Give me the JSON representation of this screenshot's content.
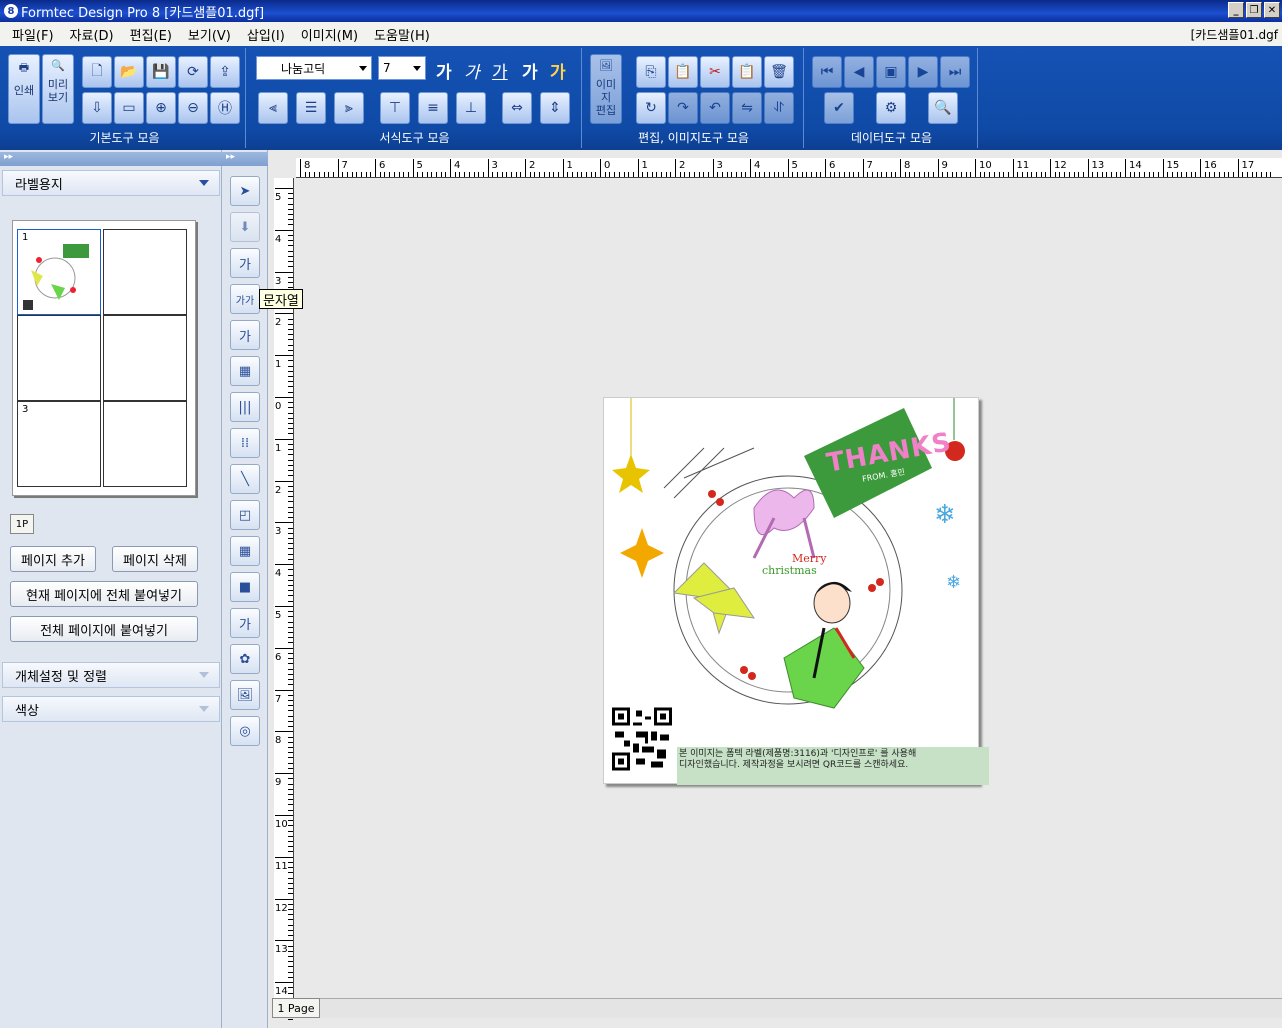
{
  "window": {
    "title": "Formtec Design Pro 8 [카드샘플01.dgf]",
    "doc_label": "[카드샘플01.dgf"
  },
  "menu": [
    "파일(F)",
    "자료(D)",
    "편집(E)",
    "보기(V)",
    "삽입(I)",
    "이미지(M)",
    "도움말(H)"
  ],
  "ribbon": {
    "basic": {
      "label": "기본도구 모음",
      "print": "인쇄",
      "preview_l1": "미리",
      "preview_l2": "보기"
    },
    "format": {
      "label": "서식도구 모음",
      "font": "나눔고딕",
      "size": "7",
      "ga": [
        "가",
        "가",
        "가",
        "가",
        "가"
      ]
    },
    "edit": {
      "label": "편집, 이미지도구 모음",
      "imgedit_l1": "이미지",
      "imgedit_l2": "편집"
    },
    "data": {
      "label": "데이터도구 모음"
    }
  },
  "left": {
    "paper_title": "라벨용지",
    "cells": [
      "1",
      "",
      "",
      "",
      "3",
      ""
    ],
    "page_tab": "1P",
    "add_page": "페이지 추가",
    "delete_page": "페이지 삭제",
    "paste_all_current": "현재 페이지에 전체 붙여넣기",
    "paste_all": "전체 페이지에 붙여넣기",
    "object_settings": "개체설정 및 정렬",
    "color": "색상"
  },
  "tooltip": "문자열",
  "ruler": {
    "h": [
      "8",
      "7",
      "6",
      "5",
      "4",
      "3",
      "2",
      "1",
      "0",
      "1",
      "2",
      "3",
      "4",
      "5",
      "6",
      "7",
      "8",
      "9",
      "10",
      "11",
      "12",
      "13",
      "14",
      "15",
      "16",
      "17"
    ],
    "v": [
      "5",
      "4",
      "3",
      "2",
      "1",
      "0",
      "1",
      "2",
      "3",
      "4",
      "5",
      "6",
      "7",
      "8",
      "9",
      "10",
      "11",
      "12",
      "13",
      "14"
    ]
  },
  "card": {
    "thanks": "THANKS",
    "from": "FROM. 홍민",
    "merry": "Merry",
    "christmas": "christmas",
    "caption_l1": "본 이미지는 폼텍 라벨(제품명:3116)과 '디자인프로' 를 사용해",
    "caption_l2": "디자인했습니다. 제작과정을 보시려면 QR코드를 스캔하세요."
  },
  "page_tab": "1 Page",
  "colors": {
    "ribbon": "#1552b4",
    "thanks": "#f080c8",
    "tag": "#3c9a3c",
    "caption_bg": "#c6e1c6"
  }
}
